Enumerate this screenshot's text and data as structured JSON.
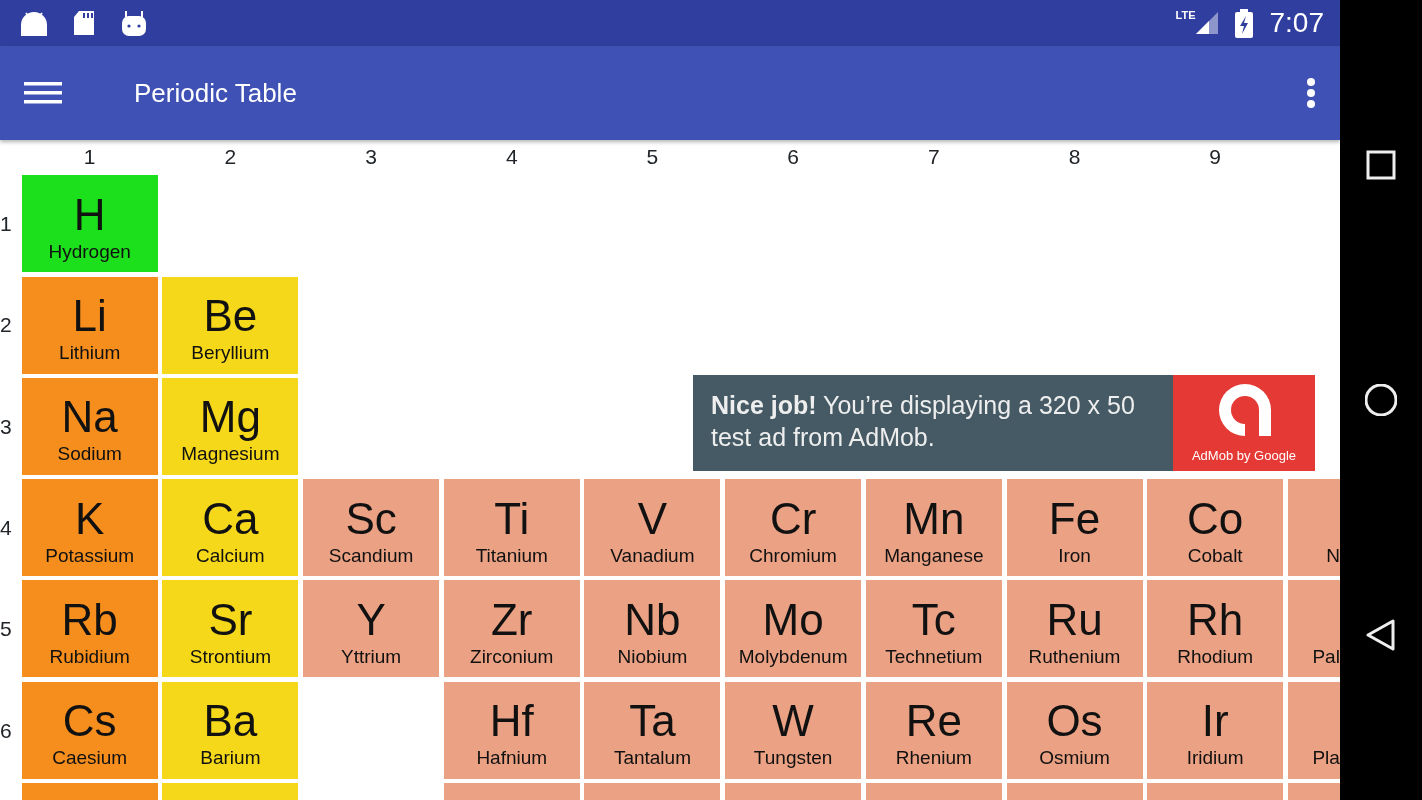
{
  "status_bar": {
    "network": "LTE",
    "time": "7:07"
  },
  "toolbar": {
    "title": "Periodic Table"
  },
  "column_headers": [
    "1",
    "2",
    "3",
    "4",
    "5",
    "6",
    "7",
    "8",
    "9"
  ],
  "rows": [
    {
      "label": "1",
      "cells": [
        {
          "kind": "element",
          "symbol": "H",
          "name": "Hydrogen",
          "color": "#1de01d"
        }
      ]
    },
    {
      "label": "2",
      "cells": [
        {
          "kind": "element",
          "symbol": "Li",
          "name": "Lithium",
          "color": "#f68e1d"
        },
        {
          "kind": "element",
          "symbol": "Be",
          "name": "Beryllium",
          "color": "#f6d81a"
        }
      ]
    },
    {
      "label": "3",
      "cells": [
        {
          "kind": "element",
          "symbol": "Na",
          "name": "Sodium",
          "color": "#f68e1d"
        },
        {
          "kind": "element",
          "symbol": "Mg",
          "name": "Magnesium",
          "color": "#f6d81a"
        }
      ]
    },
    {
      "label": "4",
      "cells": [
        {
          "kind": "element",
          "symbol": "K",
          "name": "Potassium",
          "color": "#f68e1d"
        },
        {
          "kind": "element",
          "symbol": "Ca",
          "name": "Calcium",
          "color": "#f6d81a"
        },
        {
          "kind": "element",
          "symbol": "Sc",
          "name": "Scandium",
          "color": "#eba183"
        },
        {
          "kind": "element",
          "symbol": "Ti",
          "name": "Titanium",
          "color": "#eba183"
        },
        {
          "kind": "element",
          "symbol": "V",
          "name": "Vanadium",
          "color": "#eba183"
        },
        {
          "kind": "element",
          "symbol": "Cr",
          "name": "Chromium",
          "color": "#eba183"
        },
        {
          "kind": "element",
          "symbol": "Mn",
          "name": "Manganese",
          "color": "#eba183"
        },
        {
          "kind": "element",
          "symbol": "Fe",
          "name": "Iron",
          "color": "#eba183"
        },
        {
          "kind": "element",
          "symbol": "Co",
          "name": "Cobalt",
          "color": "#eba183"
        },
        {
          "kind": "element",
          "name": "N",
          "color": "#eba183"
        }
      ]
    },
    {
      "label": "5",
      "cells": [
        {
          "kind": "element",
          "symbol": "Rb",
          "name": "Rubidium",
          "color": "#f68e1d"
        },
        {
          "kind": "element",
          "symbol": "Sr",
          "name": "Strontium",
          "color": "#f6d81a"
        },
        {
          "kind": "element",
          "symbol": "Y",
          "name": "Yttrium",
          "color": "#eba183"
        },
        {
          "kind": "element",
          "symbol": "Zr",
          "name": "Zirconium",
          "color": "#eba183"
        },
        {
          "kind": "element",
          "symbol": "Nb",
          "name": "Niobium",
          "color": "#eba183"
        },
        {
          "kind": "element",
          "symbol": "Mo",
          "name": "Molybdenum",
          "color": "#eba183"
        },
        {
          "kind": "element",
          "symbol": "Tc",
          "name": "Technetium",
          "color": "#eba183"
        },
        {
          "kind": "element",
          "symbol": "Ru",
          "name": "Ruthenium",
          "color": "#eba183"
        },
        {
          "kind": "element",
          "symbol": "Rh",
          "name": "Rhodium",
          "color": "#eba183"
        },
        {
          "kind": "element",
          "name": "Pal",
          "color": "#eba183"
        }
      ]
    },
    {
      "label": "6",
      "cells": [
        {
          "kind": "element",
          "symbol": "Cs",
          "name": "Caesium",
          "color": "#f68e1d"
        },
        {
          "kind": "element",
          "symbol": "Ba",
          "name": "Barium",
          "color": "#f6d81a"
        },
        {
          "kind": "empty"
        },
        {
          "kind": "element",
          "symbol": "Hf",
          "name": "Hafnium",
          "color": "#eba183"
        },
        {
          "kind": "element",
          "symbol": "Ta",
          "name": "Tantalum",
          "color": "#eba183"
        },
        {
          "kind": "element",
          "symbol": "W",
          "name": "Tungsten",
          "color": "#eba183"
        },
        {
          "kind": "element",
          "symbol": "Re",
          "name": "Rhenium",
          "color": "#eba183"
        },
        {
          "kind": "element",
          "symbol": "Os",
          "name": "Osmium",
          "color": "#eba183"
        },
        {
          "kind": "element",
          "symbol": "Ir",
          "name": "Iridium",
          "color": "#eba183"
        },
        {
          "kind": "element",
          "name": "Pla",
          "color": "#eba183"
        }
      ]
    },
    {
      "cells": [
        {
          "kind": "element",
          "color": "#f68e1d"
        },
        {
          "kind": "element",
          "color": "#f6d81a"
        },
        {
          "kind": "empty"
        },
        {
          "kind": "element",
          "color": "#eba183"
        },
        {
          "kind": "element",
          "color": "#eba183"
        },
        {
          "kind": "element",
          "color": "#eba183"
        },
        {
          "kind": "element",
          "color": "#eba183"
        },
        {
          "kind": "element",
          "color": "#eba183"
        },
        {
          "kind": "element",
          "color": "#eba183"
        },
        {
          "kind": "element",
          "color": "#eba183"
        }
      ]
    }
  ],
  "ad": {
    "text": "**Nice job!** You’re displaying a 320 x 50 test ad from AdMob.",
    "logo_caption": "AdMob by Google"
  }
}
